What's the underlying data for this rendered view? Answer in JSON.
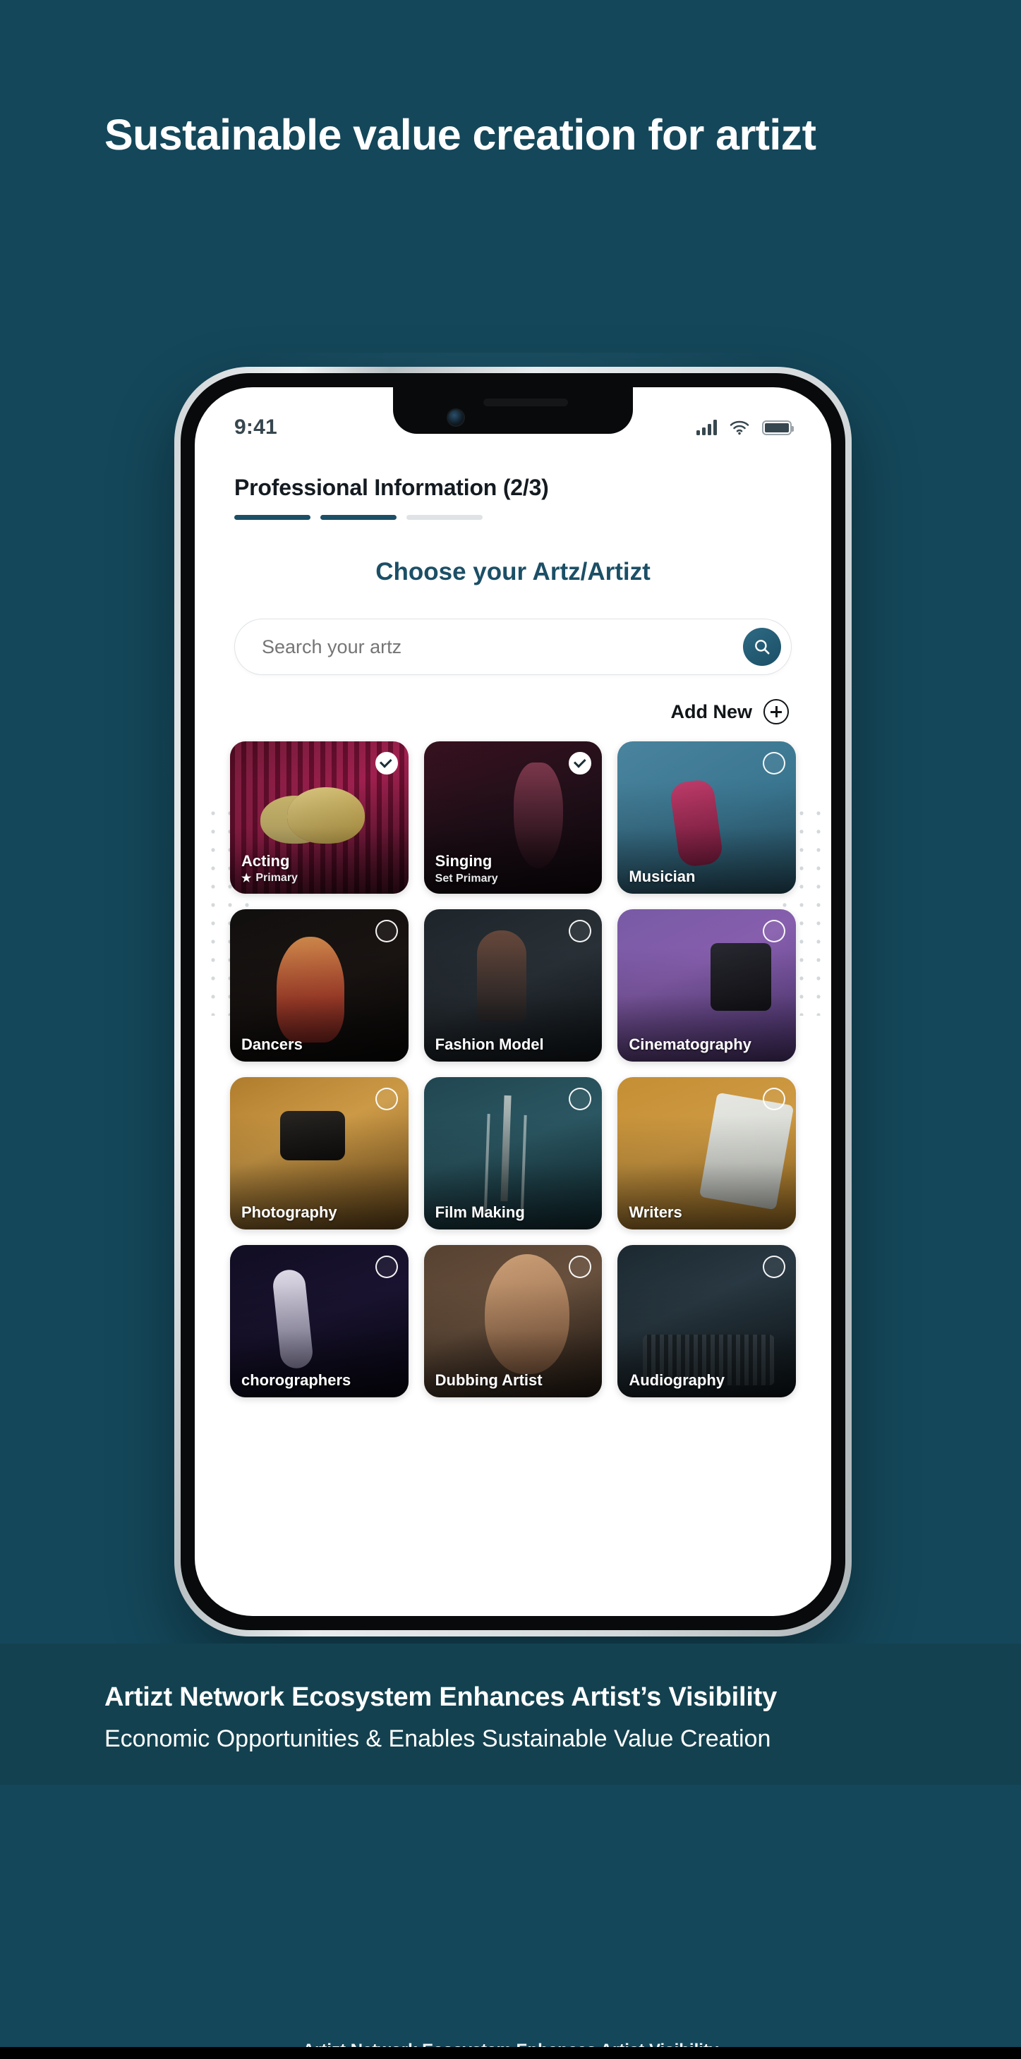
{
  "hero": {
    "headline": "Sustainable value creation for artizt",
    "background_color": "#14475a"
  },
  "phone": {
    "status_bar": {
      "time": "9:41",
      "signal_icon": "signal-bars-icon",
      "wifi_icon": "wifi-icon",
      "battery_icon": "battery-icon"
    },
    "screen": {
      "step_title": "Professional Information (2/3)",
      "progress": {
        "total_segments": 3,
        "completed_segments": 2
      },
      "section_title": "Choose your Artz/Artizt",
      "search": {
        "placeholder": "Search your artz",
        "value": "",
        "button_icon": "search-icon"
      },
      "add_new": {
        "label": "Add New",
        "icon": "plus-circle-icon"
      },
      "cards": [
        {
          "label": "Acting",
          "sub": "Primary",
          "starred": true,
          "selected": true,
          "art": "art-acting"
        },
        {
          "label": "Singing",
          "sub": "Set Primary",
          "starred": false,
          "selected": true,
          "art": "art-singing"
        },
        {
          "label": "Musician",
          "sub": "",
          "starred": false,
          "selected": false,
          "art": "art-musician"
        },
        {
          "label": "Dancers",
          "sub": "",
          "starred": false,
          "selected": false,
          "art": "art-dancers"
        },
        {
          "label": "Fashion Model",
          "sub": "",
          "starred": false,
          "selected": false,
          "art": "art-fashion"
        },
        {
          "label": "Cinematography",
          "sub": "",
          "starred": false,
          "selected": false,
          "art": "art-cinema"
        },
        {
          "label": "Photography",
          "sub": "",
          "starred": false,
          "selected": false,
          "art": "art-photography"
        },
        {
          "label": "Film Making",
          "sub": "",
          "starred": false,
          "selected": false,
          "art": "art-filmmaking"
        },
        {
          "label": "Writers",
          "sub": "",
          "starred": false,
          "selected": false,
          "art": "art-writers"
        },
        {
          "label": "chorographers",
          "sub": "",
          "starred": false,
          "selected": false,
          "art": "art-choreo"
        },
        {
          "label": "Dubbing Artist",
          "sub": "",
          "starred": false,
          "selected": false,
          "art": "art-dubbing"
        },
        {
          "label": "Audiography",
          "sub": "",
          "starred": false,
          "selected": false,
          "art": "art-audio"
        }
      ]
    }
  },
  "caption": {
    "title": "Artizt Network Ecosystem Enhances Artist’s Visibility",
    "subtitle": "Economic Opportunities & Enables Sustainable Value Creation",
    "cut_off_line": "Artizt Network Ecosystem Enhances Artist Visibility"
  }
}
